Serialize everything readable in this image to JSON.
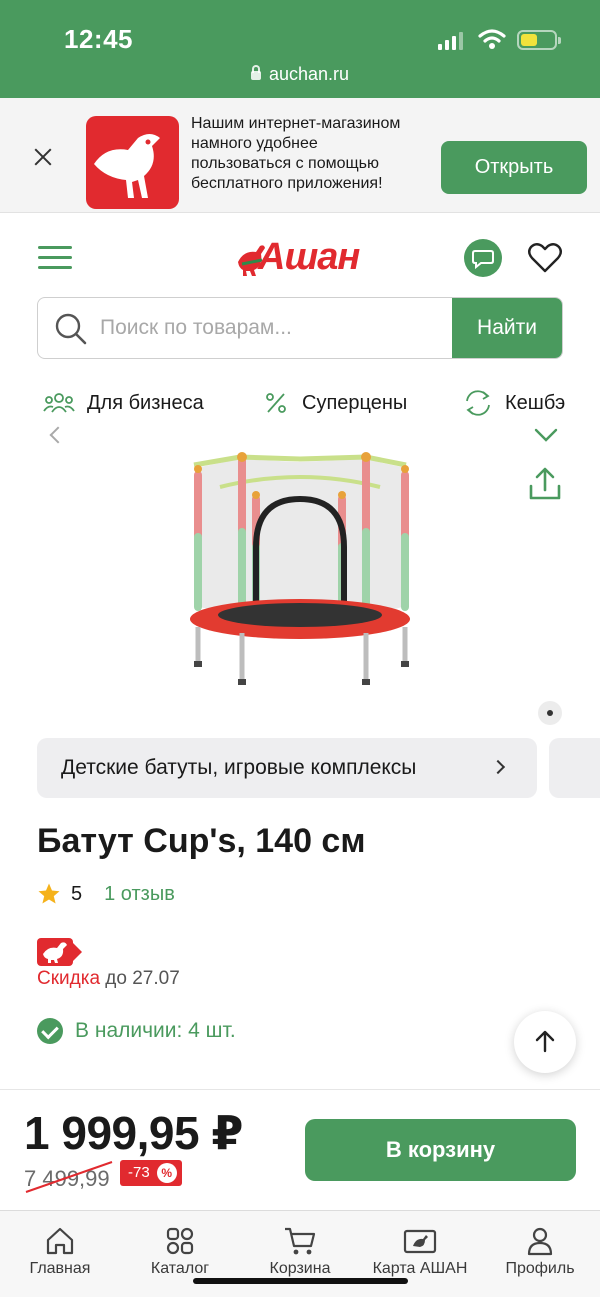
{
  "status_bar": {
    "time": "12:45",
    "url": "auchan.ru",
    "battery_level": 0.5
  },
  "app_banner": {
    "text": "Нашим интернет-магазином намного удобнее пользоваться с помощью бесплатного приложения!",
    "open_label": "Открыть"
  },
  "header": {
    "brand": "Ашан"
  },
  "search": {
    "placeholder": "Поиск по товарам...",
    "button_label": "Найти"
  },
  "quick_links": [
    {
      "label": "Для бизнеса",
      "icon": "people-icon"
    },
    {
      "label": "Суперцены",
      "icon": "percent-icon"
    },
    {
      "label": "Кешбэ",
      "icon": "refresh-icon"
    }
  ],
  "category_chip": {
    "label": "Детские батуты, игровые комплексы"
  },
  "product": {
    "title": "Батут Cup's, 140 см",
    "rating": "5",
    "reviews": "1 отзыв",
    "sale_label": "Скидка",
    "sale_until": " до 27.07",
    "stock": "В наличии: 4 шт."
  },
  "pricing": {
    "price": "1 999,95 ₽",
    "old_price": "7 499,99",
    "discount": "-73",
    "discount_symbol": "%",
    "cart_label": "В корзину"
  },
  "tabs": [
    {
      "label": "Главная",
      "icon": "home-icon"
    },
    {
      "label": "Каталог",
      "icon": "catalog-icon"
    },
    {
      "label": "Корзина",
      "icon": "cart-icon"
    },
    {
      "label": "Карта АШАН",
      "icon": "card-icon"
    },
    {
      "label": "Профиль",
      "icon": "profile-icon"
    }
  ],
  "colors": {
    "accent_green": "#4a9a5e",
    "brand_red": "#e12a2f"
  }
}
